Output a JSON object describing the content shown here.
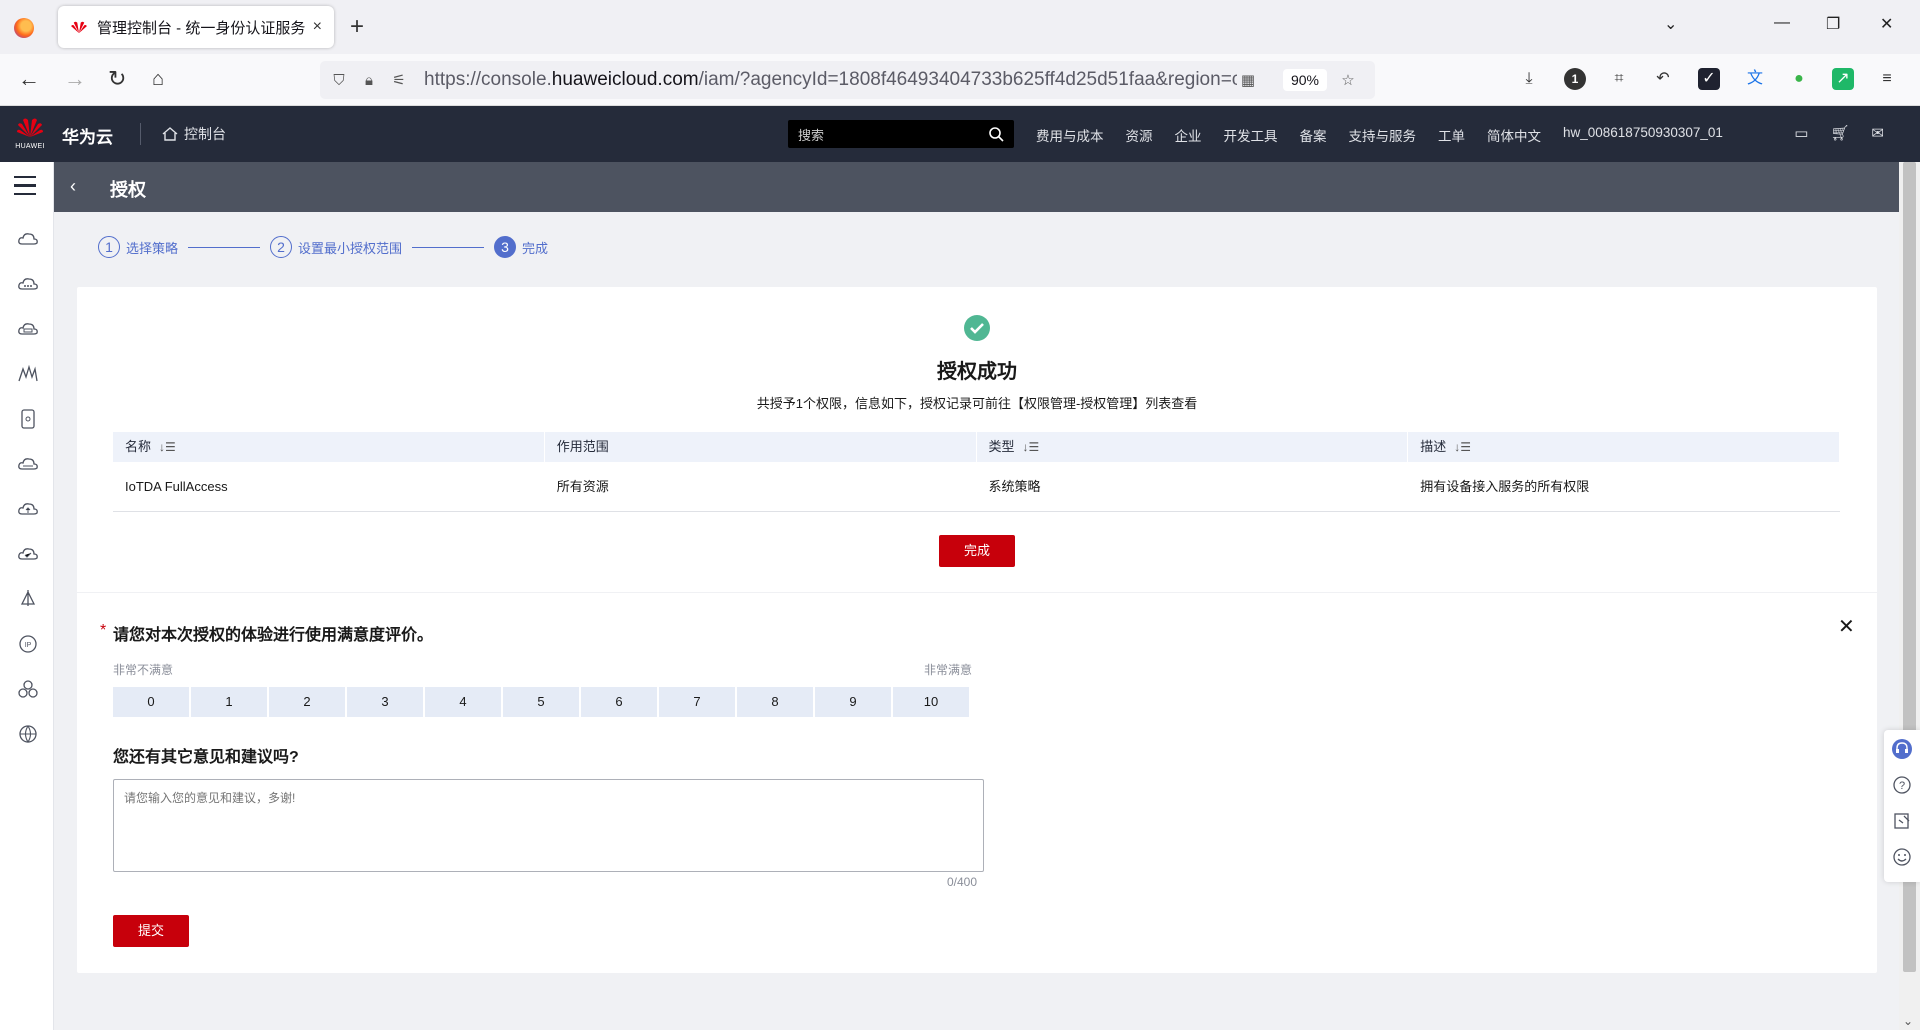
{
  "browser": {
    "tab_title": "管理控制台 - 统一身份认证服务",
    "tab_close": "×",
    "new_tab": "+",
    "url_prefix": "https://console.",
    "url_domain": "huaweicloud.com",
    "url_rest": "/iam/?agencyId=1808f46493404733b625ff4d25d51faa&region=c",
    "zoom": "90%",
    "ext_badge": "1"
  },
  "header": {
    "logo_word": "HUAWEI",
    "brand": "华为云",
    "console_label": "控制台",
    "search_placeholder": "搜索",
    "menu": [
      "费用与成本",
      "资源",
      "企业",
      "开发工具",
      "备案",
      "支持与服务",
      "工单",
      "简体中文",
      "hw_008618750930307_01"
    ]
  },
  "page": {
    "title": "授权"
  },
  "steps": [
    {
      "num": "1",
      "label": "选择策略"
    },
    {
      "num": "2",
      "label": "设置最小授权范围"
    },
    {
      "num": "3",
      "label": "完成"
    }
  ],
  "result": {
    "title": "授权成功",
    "subtitle": "共授予1个权限，信息如下，授权记录可前往【权限管理-授权管理】列表查看",
    "columns": [
      "名称",
      "作用范围",
      "类型",
      "描述"
    ],
    "rows": [
      {
        "name": "IoTDA FullAccess",
        "scope": "所有资源",
        "type": "系统策略",
        "desc": "拥有设备接入服务的所有权限"
      }
    ],
    "done_label": "完成"
  },
  "survey": {
    "required_mark": "*",
    "question1": "请您对本次授权的体验进行使用满意度评价。",
    "scale_low": "非常不满意",
    "scale_high": "非常满意",
    "scale": [
      "0",
      "1",
      "2",
      "3",
      "4",
      "5",
      "6",
      "7",
      "8",
      "9",
      "10"
    ],
    "question2": "您还有其它意见和建议吗?",
    "comment_placeholder": "请您输入您的意见和建议，多谢!",
    "counter": "0/400",
    "submit_label": "提交",
    "close": "✕"
  },
  "colors": {
    "primary_red": "#c7000b",
    "link_blue": "#526ecc",
    "header_bg": "#252b3a",
    "success_green": "#50b793"
  }
}
